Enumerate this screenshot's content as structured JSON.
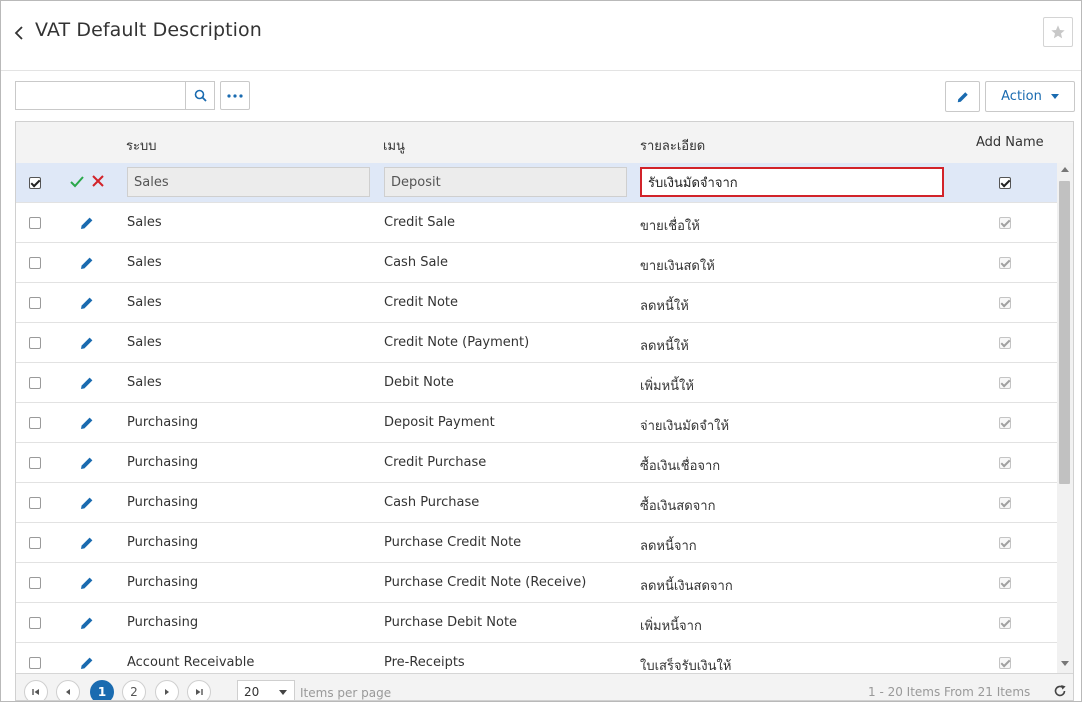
{
  "header": {
    "title": "VAT Default Description"
  },
  "toolbar": {
    "search_value": "",
    "action_label": "Action"
  },
  "columns": {
    "system": "ระบบ",
    "menu": "เมนู",
    "description": "รายละเอียด",
    "add_name": "Add Name"
  },
  "edit_row": {
    "system": "Sales",
    "menu": "Deposit",
    "description": "รับเงินมัดจำจาก",
    "selected": true,
    "add_name": true
  },
  "rows": [
    {
      "system": "Sales",
      "menu": "Credit Sale",
      "description": "ขายเชื่อให้",
      "add_name": true
    },
    {
      "system": "Sales",
      "menu": "Cash Sale",
      "description": "ขายเงินสดให้",
      "add_name": true
    },
    {
      "system": "Sales",
      "menu": "Credit Note",
      "description": "ลดหนี้ให้",
      "add_name": true
    },
    {
      "system": "Sales",
      "menu": "Credit Note (Payment)",
      "description": "ลดหนี้ให้",
      "add_name": true
    },
    {
      "system": "Sales",
      "menu": "Debit Note",
      "description": "เพิ่มหนี้ให้",
      "add_name": true
    },
    {
      "system": "Purchasing",
      "menu": "Deposit Payment",
      "description": "จ่ายเงินมัดจำให้",
      "add_name": true
    },
    {
      "system": "Purchasing",
      "menu": "Credit Purchase",
      "description": "ซื้อเงินเชื่อจาก",
      "add_name": true
    },
    {
      "system": "Purchasing",
      "menu": "Cash Purchase",
      "description": "ซื้อเงินสดจาก",
      "add_name": true
    },
    {
      "system": "Purchasing",
      "menu": "Purchase Credit Note",
      "description": "ลดหนี้จาก",
      "add_name": true
    },
    {
      "system": "Purchasing",
      "menu": "Purchase Credit Note (Receive)",
      "description": "ลดหนี้เงินสดจาก",
      "add_name": true
    },
    {
      "system": "Purchasing",
      "menu": "Purchase Debit Note",
      "description": "เพิ่มหนี้จาก",
      "add_name": true
    },
    {
      "system": "Account Receivable",
      "menu": "Pre-Receipts",
      "description": "ใบเสร็จรับเงินให้",
      "add_name": true
    }
  ],
  "pager": {
    "pages": [
      "1",
      "2"
    ],
    "current_page": "1",
    "page_size": "20",
    "items_per_page_label": "Items per page",
    "range_text": "1 - 20 Items From 21 Items"
  },
  "colors": {
    "accent": "#1a6bb0",
    "selected_row": "#dfe8f7",
    "active_border": "#d2232a",
    "confirm": "#2aa84a",
    "cancel": "#d2232a"
  }
}
